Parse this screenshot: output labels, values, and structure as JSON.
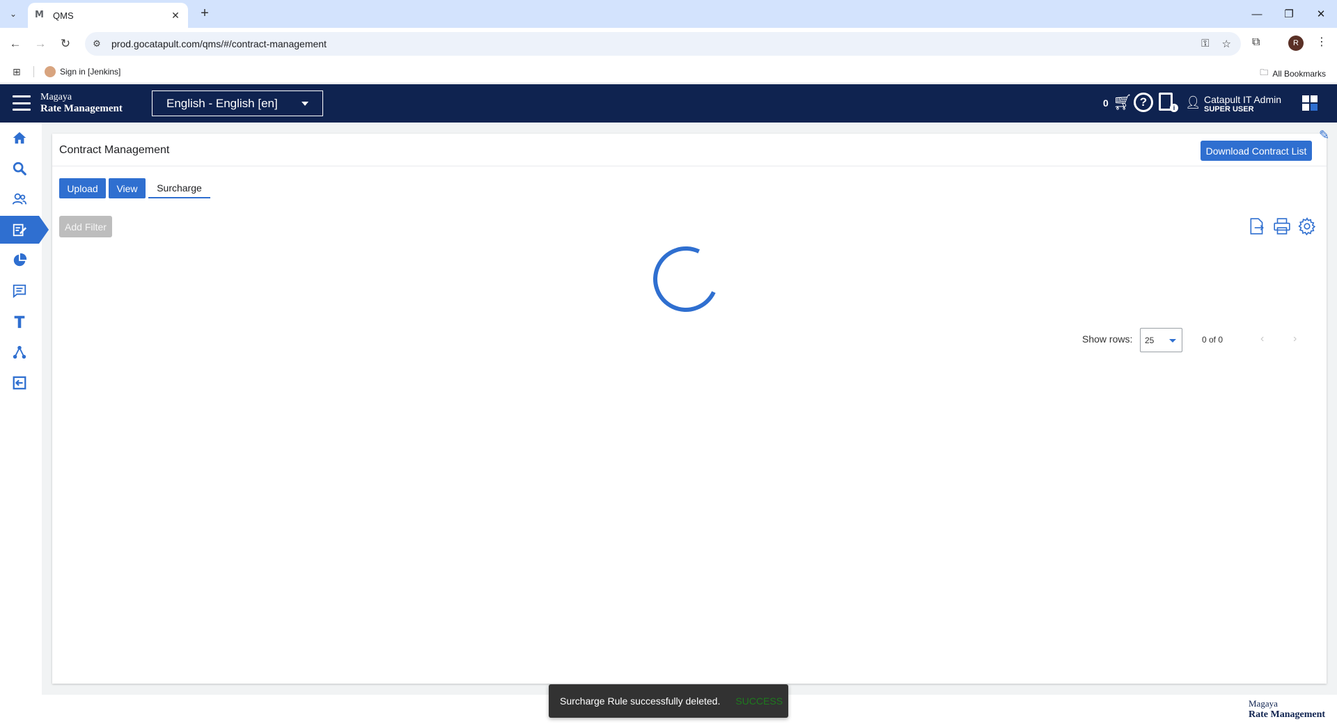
{
  "browser": {
    "tab_title": "QMS",
    "tab_favicon": "M",
    "url": "prod.gocatapult.com/qms/#/contract-management",
    "bookmark_item": "Sign in [Jenkins]",
    "all_bookmarks": "All Bookmarks",
    "profile_initial": "R"
  },
  "header": {
    "brand_line1": "Magaya",
    "brand_line2": "Rate Management",
    "language": "English - English [en]",
    "cart_count": "0",
    "user_name": "Catapult IT Admin",
    "user_role": "SUPER USER"
  },
  "sidebar": {
    "items": [
      {
        "icon": "home-icon"
      },
      {
        "icon": "search-icon"
      },
      {
        "icon": "users-icon"
      },
      {
        "icon": "contract-edit-icon",
        "active": true
      },
      {
        "icon": "pie-chart-icon"
      },
      {
        "icon": "message-icon"
      },
      {
        "icon": "text-icon"
      },
      {
        "icon": "network-icon"
      },
      {
        "icon": "logout-icon"
      }
    ]
  },
  "main": {
    "title": "Contract Management",
    "download_button": "Download Contract List",
    "tabs": [
      "Upload",
      "View",
      "Surcharge"
    ],
    "active_tab": "Surcharge",
    "add_filter": "Add Filter",
    "show_rows_label": "Show rows:",
    "rows_value": "25",
    "page_count": "0 of 0"
  },
  "toast": {
    "message": "Surcharge Rule successfully deleted.",
    "action": "SUCCESS"
  },
  "footer": {
    "brand_line1": "Magaya",
    "brand_line2": "Rate Management"
  },
  "colors": {
    "header_bg": "#0f2350",
    "accent": "#2f6fd0",
    "browser_tabbar": "#d3e3fd"
  }
}
